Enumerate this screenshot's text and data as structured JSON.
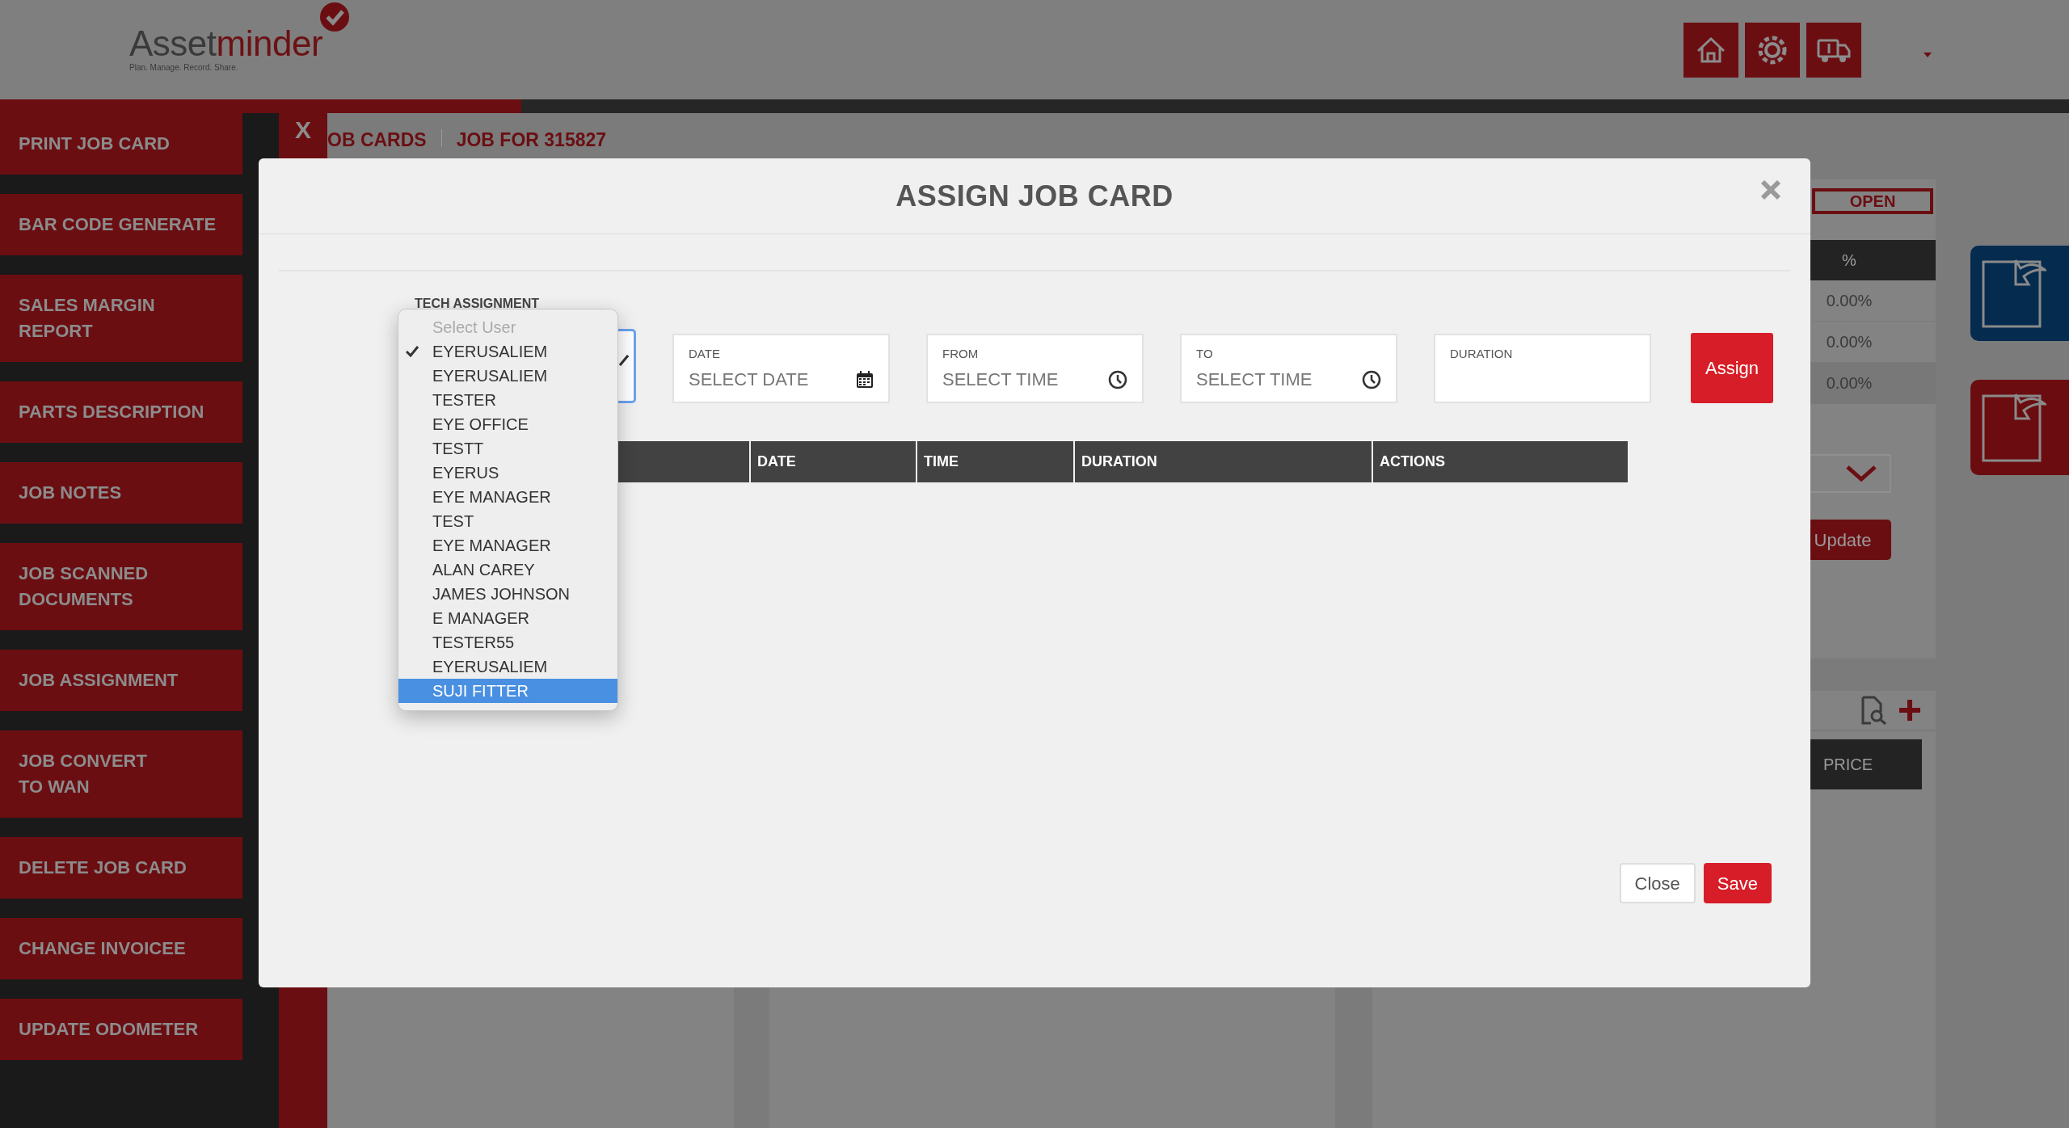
{
  "header": {
    "logo_primary": "Asset",
    "logo_accent": "minder",
    "tagline": "Plan. Manage. Record. Share."
  },
  "sidebar": {
    "items": [
      "PRINT JOB CARD",
      "BAR CODE GENERATE",
      "SALES MARGIN REPORT",
      "PARTS DESCRIPTION",
      "JOB NOTES",
      "JOB SCANNED DOCUMENTS",
      "JOB ASSIGNMENT",
      "JOB CONVERT TO WAN",
      "DELETE JOB CARD",
      "CHANGE INVOICEE",
      "UPDATE ODOMETER"
    ],
    "close_label": "X"
  },
  "breadcrumb": [
    "OB CARDS",
    "JOB FOR 315827"
  ],
  "status_card": {
    "status": "OPEN",
    "table": {
      "column": "%",
      "rows": [
        "0.00%",
        "0.00%",
        "0.00%"
      ]
    },
    "update_button": "Update"
  },
  "parts_card": {
    "columns": [
      "PRICE"
    ]
  },
  "modal": {
    "title": "ASSIGN JOB CARD",
    "tech_assignment": {
      "label": "TECH ASSIGNMENT",
      "placeholder": "Select User",
      "options": [
        {
          "label": "EYERUSALIEM",
          "selected": true,
          "highlighted": false
        },
        {
          "label": "EYERUSALIEM",
          "selected": false,
          "highlighted": false
        },
        {
          "label": "TESTER",
          "selected": false,
          "highlighted": false
        },
        {
          "label": "EYE OFFICE",
          "selected": false,
          "highlighted": false
        },
        {
          "label": "TESTT",
          "selected": false,
          "highlighted": false
        },
        {
          "label": "EYERUS",
          "selected": false,
          "highlighted": false
        },
        {
          "label": "EYE MANAGER",
          "selected": false,
          "highlighted": false
        },
        {
          "label": "TEST",
          "selected": false,
          "highlighted": false
        },
        {
          "label": "EYE MANAGER",
          "selected": false,
          "highlighted": false
        },
        {
          "label": "ALAN CAREY",
          "selected": false,
          "highlighted": false
        },
        {
          "label": "JAMES JOHNSON",
          "selected": false,
          "highlighted": false
        },
        {
          "label": "E MANAGER",
          "selected": false,
          "highlighted": false
        },
        {
          "label": "TESTER55",
          "selected": false,
          "highlighted": false
        },
        {
          "label": "EYERUSALIEM",
          "selected": false,
          "highlighted": false
        },
        {
          "label": "SUJI FITTER",
          "selected": false,
          "highlighted": true
        }
      ]
    },
    "fields": [
      {
        "label": "DATE",
        "placeholder": "SELECT DATE",
        "kind": "date"
      },
      {
        "label": "FROM",
        "placeholder": "SELECT TIME",
        "kind": "time"
      },
      {
        "label": "TO",
        "placeholder": "SELECT TIME",
        "kind": "time"
      },
      {
        "label": "DURATION",
        "kind": "text"
      }
    ],
    "assign_button": "Assign",
    "table": {
      "columns": [
        "DATE",
        "TIME",
        "DURATION",
        "ACTIONS"
      ]
    },
    "buttons": [
      {
        "label": "Close",
        "kind": "secondary"
      },
      {
        "label": "Save",
        "kind": "primary"
      }
    ]
  }
}
